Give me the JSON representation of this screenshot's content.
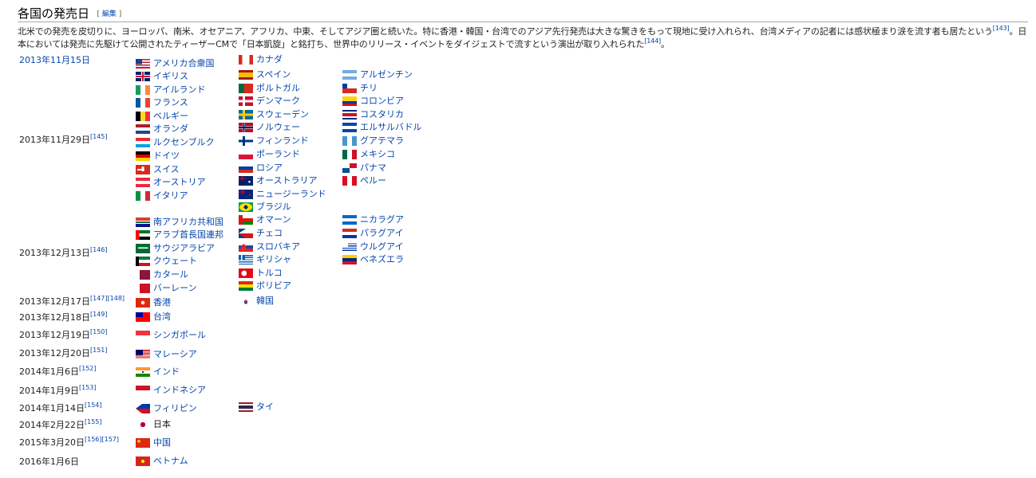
{
  "section": {
    "title": "各国の発売日",
    "edit": "編集"
  },
  "intro": {
    "line1": "北米での発売を皮切りに、ヨーロッパ、南米、オセアニア、アフリカ、中東、そしてアジア圏と続いた。特に香港・韓国・台湾でのアジア先行発売は大きな驚きをもって現地に受け入れられ、台湾メディアの記者には感状極まり涙を流す者も居たという",
    "ref1": "[143]",
    "line2": "。日本においては発売に先駆けて公開されたティーザーCMで「日本凱旋」と銘打ち、世界中のリリース・イベントをダイジェストで流すという演出が取り入れられた",
    "ref2": "[144]",
    "end": "。"
  },
  "dates": [
    {
      "label": "2013年11月15日",
      "link": true,
      "ref": ""
    },
    {
      "label": "2013年11月29日",
      "link": false,
      "ref": "[145]"
    },
    {
      "label": "2013年12月13日",
      "link": false,
      "ref": "[146]"
    },
    {
      "label": "2013年12月17日",
      "link": false,
      "ref": "[147][148]"
    },
    {
      "label": "2013年12月18日",
      "link": false,
      "ref": "[149]"
    },
    {
      "label": "2013年12月19日",
      "link": false,
      "ref": "[150]"
    },
    {
      "label": "2013年12月20日",
      "link": false,
      "ref": "[151]"
    },
    {
      "label": "2014年1月6日",
      "link": false,
      "ref": "[152]"
    },
    {
      "label": "2014年1月9日",
      "link": false,
      "ref": "[153]"
    },
    {
      "label": "2014年1月14日",
      "link": false,
      "ref": "[154]"
    },
    {
      "label": "2014年2月22日",
      "link": false,
      "ref": "[155]"
    },
    {
      "label": "2015年3月20日",
      "link": false,
      "ref": "[156][157]"
    },
    {
      "label": "2016年1月6日",
      "link": false,
      "ref": ""
    }
  ],
  "countries": [
    {
      "name": "アメリカ合衆国",
      "flag": "usa"
    },
    {
      "name": "カナダ",
      "flag": "canada"
    },
    {
      "name": "イギリス",
      "flag": "uk"
    },
    {
      "name": "スペイン",
      "flag": "spain"
    },
    {
      "name": "アルゼンチン",
      "flag": "argentina"
    },
    {
      "name": "アイルランド",
      "flag": "ireland"
    },
    {
      "name": "ポルトガル",
      "flag": "portugal"
    },
    {
      "name": "チリ",
      "flag": "chile"
    },
    {
      "name": "フランス",
      "flag": "france"
    },
    {
      "name": "デンマーク",
      "flag": "denmark"
    },
    {
      "name": "コロンビア",
      "flag": "colombia"
    },
    {
      "name": "ベルギー",
      "flag": "belgium"
    },
    {
      "name": "スウェーデン",
      "flag": "sweden"
    },
    {
      "name": "コスタリカ",
      "flag": "costarica"
    },
    {
      "name": "オランダ",
      "flag": "netherlands"
    },
    {
      "name": "ノルウェー",
      "flag": "norway"
    },
    {
      "name": "エルサルバドル",
      "flag": "elsalvador"
    },
    {
      "name": "ルクセンブルク",
      "flag": "luxembourg"
    },
    {
      "name": "フィンランド",
      "flag": "finland"
    },
    {
      "name": "グアテマラ",
      "flag": "guatemala"
    },
    {
      "name": "ドイツ",
      "flag": "germany"
    },
    {
      "name": "ポーランド",
      "flag": "poland"
    },
    {
      "name": "メキシコ",
      "flag": "mexico"
    },
    {
      "name": "スイス",
      "flag": "switzerland"
    },
    {
      "name": "ロシア",
      "flag": "russia"
    },
    {
      "name": "パナマ",
      "flag": "panama"
    },
    {
      "name": "オーストリア",
      "flag": "austria"
    },
    {
      "name": "オーストラリア",
      "flag": "australia"
    },
    {
      "name": "ペルー",
      "flag": "peru"
    },
    {
      "name": "イタリア",
      "flag": "italy"
    },
    {
      "name": "ニュージーランド",
      "flag": "newzealand"
    },
    {
      "name": "ブラジル",
      "flag": "brazil"
    },
    {
      "name": "南アフリカ共和国",
      "flag": "southafrica"
    },
    {
      "name": "オマーン",
      "flag": "oman"
    },
    {
      "name": "ニカラグア",
      "flag": "nicaragua"
    },
    {
      "name": "アラブ首長国連邦",
      "flag": "uae"
    },
    {
      "name": "チェコ",
      "flag": "czech"
    },
    {
      "name": "パラグアイ",
      "flag": "paraguay"
    },
    {
      "name": "サウジアラビア",
      "flag": "saudi"
    },
    {
      "name": "スロバキア",
      "flag": "slovakia"
    },
    {
      "name": "ウルグアイ",
      "flag": "uruguay"
    },
    {
      "name": "クウェート",
      "flag": "kuwait"
    },
    {
      "name": "ギリシャ",
      "flag": "greece"
    },
    {
      "name": "ベネズエラ",
      "flag": "venezuela"
    },
    {
      "name": "カタール",
      "flag": "qatar"
    },
    {
      "name": "トルコ",
      "flag": "turkey"
    },
    {
      "name": "バーレーン",
      "flag": "bahrain"
    },
    {
      "name": "ボリビア",
      "flag": "bolivia"
    },
    {
      "name": "香港",
      "flag": "hongkong"
    },
    {
      "name": "韓国",
      "flag": "korea"
    },
    {
      "name": "台湾",
      "flag": "taiwan"
    },
    {
      "name": "シンガポール",
      "flag": "singapore"
    },
    {
      "name": "マレーシア",
      "flag": "malaysia"
    },
    {
      "name": "インド",
      "flag": "india"
    },
    {
      "name": "インドネシア",
      "flag": "indonesia"
    },
    {
      "name": "フィリピン",
      "flag": "philippines"
    },
    {
      "name": "タイ",
      "flag": "thailand"
    },
    {
      "name": "日本",
      "flag": "japan",
      "plain": true
    },
    {
      "name": "中国",
      "flag": "china"
    },
    {
      "name": "ベトナム",
      "flag": "vietnam"
    }
  ],
  "flag_colors": {
    "red": "#d52b1e",
    "blue": "#1f3a93",
    "green": "#009246",
    "yellow": "#f4c400",
    "white": "#ffffff",
    "black": "#111111"
  }
}
